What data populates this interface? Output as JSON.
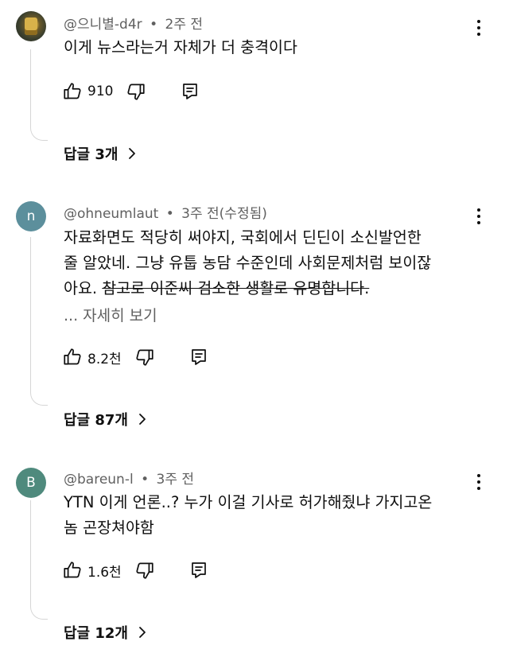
{
  "comments": [
    {
      "avatar": {
        "type": "image",
        "letter": "",
        "color": "#3a3f2e"
      },
      "author": "@으니별-d4r",
      "time": "2주 전",
      "edited": "",
      "lines": [
        "이게 뉴스라는거 자체가 더 충격이다"
      ],
      "strike_text": "",
      "show_more": "",
      "likes": "910",
      "replies": "답글 3개"
    },
    {
      "avatar": {
        "type": "letter",
        "letter": "n",
        "color": "#5c8f9c"
      },
      "author": "@ohneumlaut",
      "time": "3주 전",
      "edited": "(수정됨)",
      "lines": [
        "자료화면도 적당히 써야지, 국회에서 딘딘이 소신발언한",
        "줄 알았네. 그냥 유툽 농담 수준인데 사회문제처럼 보이잖",
        "아요."
      ],
      "strike_text": "참고로 이준씨 검소한 생활로 유명합니다.",
      "show_more": "... 자세히 보기",
      "likes": "8.2천",
      "replies": "답글 87개"
    },
    {
      "avatar": {
        "type": "letter",
        "letter": "B",
        "color": "#4f8a7d"
      },
      "author": "@bareun-l",
      "time": "3주 전",
      "edited": "",
      "lines": [
        "YTN 이게 언론..? 누가 이걸 기사로 허가해줬냐 가지고온",
        "놈 곤장쳐야함"
      ],
      "strike_text": "",
      "show_more": "",
      "likes": "1.6천",
      "replies": "답글 12개"
    }
  ],
  "meta_separator": "•",
  "icons": {
    "like": "thumb-up-icon",
    "dislike": "thumb-down-icon",
    "reply": "reply-icon",
    "menu": "more-vert-icon",
    "expand": "chevron-right-icon"
  }
}
